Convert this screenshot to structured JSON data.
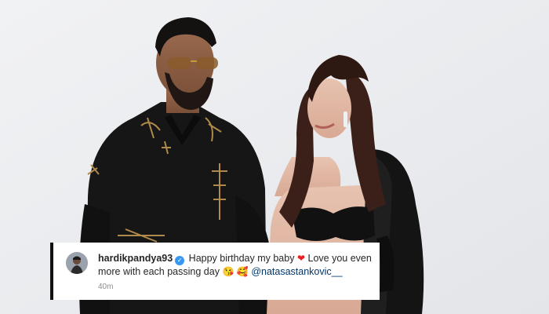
{
  "comment": {
    "username": "hardikpandya93",
    "verified_icon": "verified-badge-icon",
    "text_before_heart": "Happy birthday my baby",
    "heart_emoji": "❤",
    "text_after_heart": "Love you even more with each passing day",
    "emoji_1": "😘",
    "emoji_2": "🥰",
    "mention": "@natasastankovic__",
    "timestamp": "40m"
  },
  "colors": {
    "background": "#ecedf0",
    "verified": "#3897f0",
    "heart": "#ed1c24",
    "mention": "#00376b",
    "timestamp": "#8e8e8e"
  }
}
